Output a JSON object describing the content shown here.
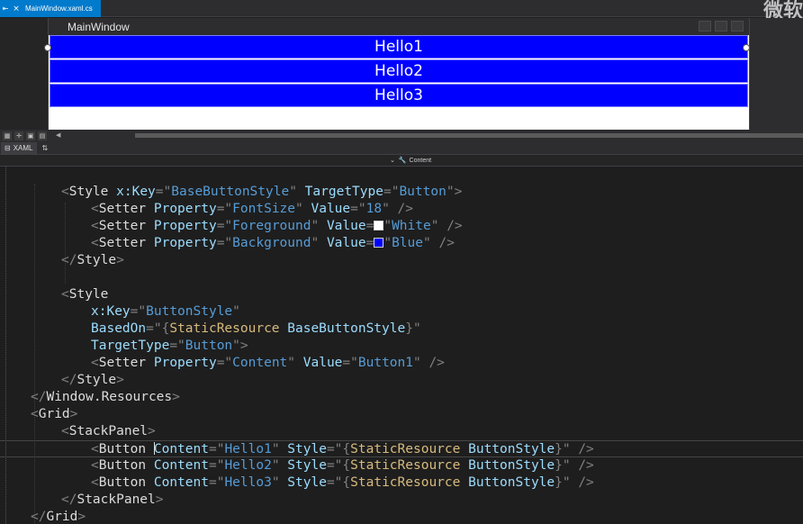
{
  "tab": {
    "title": "MainWindow.xaml.cs",
    "pin": "⇤",
    "close": "×"
  },
  "watermark": "微软",
  "designer": {
    "window_title": "MainWindow",
    "buttons": [
      "Hello1",
      "Hello2",
      "Hello3"
    ]
  },
  "pane": {
    "xaml_tab": "XAML",
    "nav_label": "Content",
    "nav_dropdown": "⌄"
  },
  "code_lines": [
    [
      {
        "c": "b",
        "t": "<"
      },
      {
        "c": "t",
        "t": "Style"
      },
      {
        "c": "p",
        "t": " "
      },
      {
        "c": "a",
        "t": "x:Key"
      },
      {
        "c": "b",
        "t": "=\""
      },
      {
        "c": "v",
        "t": "BaseButtonStyle"
      },
      {
        "c": "b",
        "t": "\""
      },
      {
        "c": "p",
        "t": " "
      },
      {
        "c": "a",
        "t": "TargetType"
      },
      {
        "c": "b",
        "t": "=\""
      },
      {
        "c": "v",
        "t": "Button"
      },
      {
        "c": "b",
        "t": "\">"
      }
    ],
    [
      {
        "c": "b",
        "t": "<"
      },
      {
        "c": "t",
        "t": "Setter"
      },
      {
        "c": "p",
        "t": " "
      },
      {
        "c": "a",
        "t": "Property"
      },
      {
        "c": "b",
        "t": "=\""
      },
      {
        "c": "v",
        "t": "FontSize"
      },
      {
        "c": "b",
        "t": "\""
      },
      {
        "c": "p",
        "t": " "
      },
      {
        "c": "a",
        "t": "Value"
      },
      {
        "c": "b",
        "t": "=\""
      },
      {
        "c": "v",
        "t": "18"
      },
      {
        "c": "b",
        "t": "\" />"
      }
    ],
    [
      {
        "c": "b",
        "t": "<"
      },
      {
        "c": "t",
        "t": "Setter"
      },
      {
        "c": "p",
        "t": " "
      },
      {
        "c": "a",
        "t": "Property"
      },
      {
        "c": "b",
        "t": "=\""
      },
      {
        "c": "v",
        "t": "Foreground"
      },
      {
        "c": "b",
        "t": "\""
      },
      {
        "c": "p",
        "t": " "
      },
      {
        "c": "a",
        "t": "Value"
      },
      {
        "c": "b",
        "t": "="
      },
      {
        "c": "sw",
        "t": "#ffffff"
      },
      {
        "c": "b",
        "t": "\""
      },
      {
        "c": "v",
        "t": "White"
      },
      {
        "c": "b",
        "t": "\" />"
      }
    ],
    [
      {
        "c": "b",
        "t": "<"
      },
      {
        "c": "t",
        "t": "Setter"
      },
      {
        "c": "p",
        "t": " "
      },
      {
        "c": "a",
        "t": "Property"
      },
      {
        "c": "b",
        "t": "=\""
      },
      {
        "c": "v",
        "t": "Background"
      },
      {
        "c": "b",
        "t": "\""
      },
      {
        "c": "p",
        "t": " "
      },
      {
        "c": "a",
        "t": "Value"
      },
      {
        "c": "b",
        "t": "="
      },
      {
        "c": "sw",
        "t": "#0000ff"
      },
      {
        "c": "b",
        "t": "\""
      },
      {
        "c": "v",
        "t": "Blue"
      },
      {
        "c": "b",
        "t": "\" />"
      }
    ],
    [
      {
        "c": "b",
        "t": "</"
      },
      {
        "c": "t",
        "t": "Style"
      },
      {
        "c": "b",
        "t": ">"
      }
    ],
    [],
    [
      {
        "c": "b",
        "t": "<"
      },
      {
        "c": "t",
        "t": "Style"
      }
    ],
    [
      {
        "c": "a",
        "t": "x:Key"
      },
      {
        "c": "b",
        "t": "=\""
      },
      {
        "c": "v",
        "t": "ButtonStyle"
      },
      {
        "c": "b",
        "t": "\""
      }
    ],
    [
      {
        "c": "a",
        "t": "BasedOn"
      },
      {
        "c": "b",
        "t": "=\"{"
      },
      {
        "c": "e",
        "t": "StaticResource"
      },
      {
        "c": "p",
        "t": " "
      },
      {
        "c": "a",
        "t": "BaseButtonStyle"
      },
      {
        "c": "b",
        "t": "}\""
      }
    ],
    [
      {
        "c": "a",
        "t": "TargetType"
      },
      {
        "c": "b",
        "t": "=\""
      },
      {
        "c": "v",
        "t": "Button"
      },
      {
        "c": "b",
        "t": "\">"
      }
    ],
    [
      {
        "c": "b",
        "t": "<"
      },
      {
        "c": "t",
        "t": "Setter"
      },
      {
        "c": "p",
        "t": " "
      },
      {
        "c": "a",
        "t": "Property"
      },
      {
        "c": "b",
        "t": "=\""
      },
      {
        "c": "v",
        "t": "Content"
      },
      {
        "c": "b",
        "t": "\""
      },
      {
        "c": "p",
        "t": " "
      },
      {
        "c": "a",
        "t": "Value"
      },
      {
        "c": "b",
        "t": "=\""
      },
      {
        "c": "v",
        "t": "Button1"
      },
      {
        "c": "b",
        "t": "\" />"
      }
    ],
    [
      {
        "c": "b",
        "t": "</"
      },
      {
        "c": "t",
        "t": "Style"
      },
      {
        "c": "b",
        "t": ">"
      }
    ],
    [
      {
        "c": "b",
        "t": "</"
      },
      {
        "c": "t",
        "t": "Window.Resources"
      },
      {
        "c": "b",
        "t": ">"
      }
    ],
    [
      {
        "c": "b",
        "t": "<"
      },
      {
        "c": "t",
        "t": "Grid"
      },
      {
        "c": "b",
        "t": ">"
      }
    ],
    [
      {
        "c": "b",
        "t": "<"
      },
      {
        "c": "t",
        "t": "StackPanel"
      },
      {
        "c": "b",
        "t": ">"
      }
    ],
    [
      {
        "c": "b",
        "t": "<"
      },
      {
        "c": "t",
        "t": "Button"
      },
      {
        "c": "p",
        "t": " "
      },
      {
        "c": "caret",
        "t": ""
      },
      {
        "c": "a",
        "t": "Content"
      },
      {
        "c": "b",
        "t": "=\""
      },
      {
        "c": "v",
        "t": "Hello1"
      },
      {
        "c": "b",
        "t": "\""
      },
      {
        "c": "p",
        "t": " "
      },
      {
        "c": "a",
        "t": "Style"
      },
      {
        "c": "b",
        "t": "=\"{"
      },
      {
        "c": "e",
        "t": "StaticResource"
      },
      {
        "c": "p",
        "t": " "
      },
      {
        "c": "a",
        "t": "ButtonStyle"
      },
      {
        "c": "b",
        "t": "}\" />"
      }
    ],
    [
      {
        "c": "b",
        "t": "<"
      },
      {
        "c": "t",
        "t": "Button"
      },
      {
        "c": "p",
        "t": " "
      },
      {
        "c": "a",
        "t": "Content"
      },
      {
        "c": "b",
        "t": "=\""
      },
      {
        "c": "v",
        "t": "Hello2"
      },
      {
        "c": "b",
        "t": "\""
      },
      {
        "c": "p",
        "t": " "
      },
      {
        "c": "a",
        "t": "Style"
      },
      {
        "c": "b",
        "t": "=\"{"
      },
      {
        "c": "e",
        "t": "StaticResource"
      },
      {
        "c": "p",
        "t": " "
      },
      {
        "c": "a",
        "t": "ButtonStyle"
      },
      {
        "c": "b",
        "t": "}\" />"
      }
    ],
    [
      {
        "c": "b",
        "t": "<"
      },
      {
        "c": "t",
        "t": "Button"
      },
      {
        "c": "p",
        "t": " "
      },
      {
        "c": "a",
        "t": "Content"
      },
      {
        "c": "b",
        "t": "=\""
      },
      {
        "c": "v",
        "t": "Hello3"
      },
      {
        "c": "b",
        "t": "\""
      },
      {
        "c": "p",
        "t": " "
      },
      {
        "c": "a",
        "t": "Style"
      },
      {
        "c": "b",
        "t": "=\"{"
      },
      {
        "c": "e",
        "t": "StaticResource"
      },
      {
        "c": "p",
        "t": " "
      },
      {
        "c": "a",
        "t": "ButtonStyle"
      },
      {
        "c": "b",
        "t": "}\" />"
      }
    ],
    [
      {
        "c": "b",
        "t": "</"
      },
      {
        "c": "t",
        "t": "StackPanel"
      },
      {
        "c": "b",
        "t": ">"
      }
    ],
    [
      {
        "c": "b",
        "t": "</"
      },
      {
        "c": "t",
        "t": "Grid"
      },
      {
        "c": "b",
        "t": ">"
      }
    ]
  ],
  "colors": {
    "accent": "#007acc",
    "button_bg": "#0000ff",
    "button_fg": "#ffffff",
    "editor_bg": "#1e1e1e"
  }
}
